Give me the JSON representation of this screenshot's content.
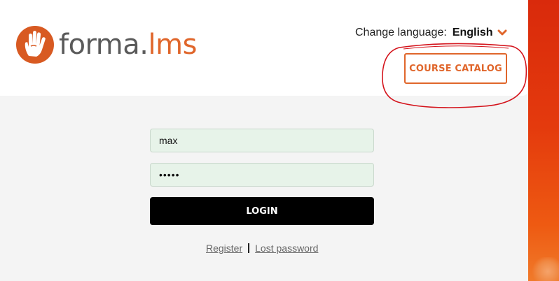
{
  "header": {
    "logo_text_forma": "forma",
    "logo_text_dot": ".",
    "logo_text_lms": "lms",
    "logo_icon": "hand-logo-icon"
  },
  "language": {
    "label": "Change language:",
    "value": "English",
    "chevron_icon": "chevron-down-icon"
  },
  "catalog_button": {
    "label": "COURSE CATALOG"
  },
  "login_form": {
    "username_value": "max",
    "password_value": "•••••",
    "login_label": "LOGIN"
  },
  "links": {
    "register": "Register",
    "lost_password": "Lost password"
  },
  "colors": {
    "brand_orange": "#e0662b",
    "field_bg": "#e7f3e9",
    "annotation_red": "#d4141c",
    "side_strip": "#e43a0d"
  }
}
